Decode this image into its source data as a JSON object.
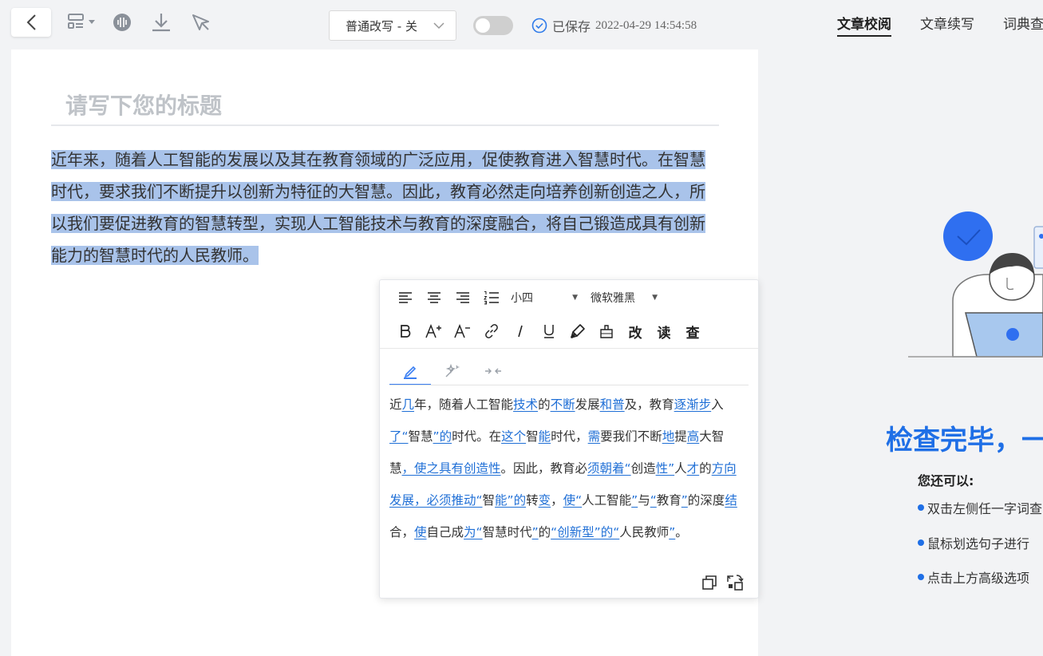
{
  "toolbar": {
    "mode_select_value": "普通改写 - 关",
    "saved_label": "已保存",
    "saved_time": "2022-04-29 14:54:58"
  },
  "tabs": [
    {
      "label": "文章校阅",
      "active": true
    },
    {
      "label": "文章续写",
      "active": false
    },
    {
      "label": "词典查询",
      "active": false
    }
  ],
  "editor": {
    "title_placeholder": "请写下您的标题",
    "body_text": "近年来，随着人工智能的发展以及其在教育领域的广泛应用，促使教育进入智慧时代。在智慧时代，要求我们不断提升以创新为特征的大智慧。因此，教育必然走向培养创新创造之人，所以我们要促进教育的智慧转型，实现人工智能技术与教育的深度融合，将自己锻造成具有创新能力的智慧时代的人民教师。"
  },
  "popup": {
    "font_size": "小四",
    "font_family": "微软雅黑",
    "btn_gai": "改",
    "btn_du": "读",
    "btn_cha": "查",
    "revised": [
      {
        "t": "近"
      },
      {
        "u": "几"
      },
      {
        "t": "年，随着人工智能"
      },
      {
        "u": "技术"
      },
      {
        "t": "的"
      },
      {
        "u": "不断"
      },
      {
        "t": "发展"
      },
      {
        "u": "和普"
      },
      {
        "t": "及，教育"
      },
      {
        "u": "逐渐步"
      },
      {
        "t": "入"
      },
      {
        "u": "了“"
      },
      {
        "t": "智慧"
      },
      {
        "u": "”的"
      },
      {
        "t": "时代。在"
      },
      {
        "u": "这个"
      },
      {
        "t": "智"
      },
      {
        "u": "能"
      },
      {
        "t": "时代，"
      },
      {
        "u": "需"
      },
      {
        "t": "要我们不断"
      },
      {
        "u": "地"
      },
      {
        "t": "提"
      },
      {
        "u": "高"
      },
      {
        "t": "大智慧"
      },
      {
        "u": "，使之具有创造性"
      },
      {
        "t": "。因此，教育必"
      },
      {
        "u": "须朝着“"
      },
      {
        "t": "创造"
      },
      {
        "u": "性”"
      },
      {
        "t": "人"
      },
      {
        "u": "才"
      },
      {
        "t": "的"
      },
      {
        "u": "方向发展，必须推动“"
      },
      {
        "t": "智"
      },
      {
        "u": "能”的"
      },
      {
        "t": "转"
      },
      {
        "u": "变"
      },
      {
        "t": "，"
      },
      {
        "u": "使“"
      },
      {
        "t": "人工智能"
      },
      {
        "u": "”"
      },
      {
        "t": "与"
      },
      {
        "u": "“"
      },
      {
        "t": "教育"
      },
      {
        "u": "”"
      },
      {
        "t": "的深度"
      },
      {
        "u": "结"
      },
      {
        "t": "合，"
      },
      {
        "u": "使"
      },
      {
        "t": "自己成"
      },
      {
        "u": "为“"
      },
      {
        "t": "智慧时代"
      },
      {
        "u": "”"
      },
      {
        "t": "的"
      },
      {
        "u": "“创新型”的“"
      },
      {
        "t": "人民教师"
      },
      {
        "u": "”"
      },
      {
        "t": "。"
      }
    ]
  },
  "right": {
    "done_title": "检查完毕，一",
    "can_label": "您还可以:",
    "tips": [
      "双击左侧任一字词查",
      "鼠标划选句子进行",
      "点击上方高级选项"
    ]
  },
  "colors": {
    "accent": "#1f6fe6",
    "selection": "#a9c3ea",
    "link": "#1f6fd6"
  }
}
